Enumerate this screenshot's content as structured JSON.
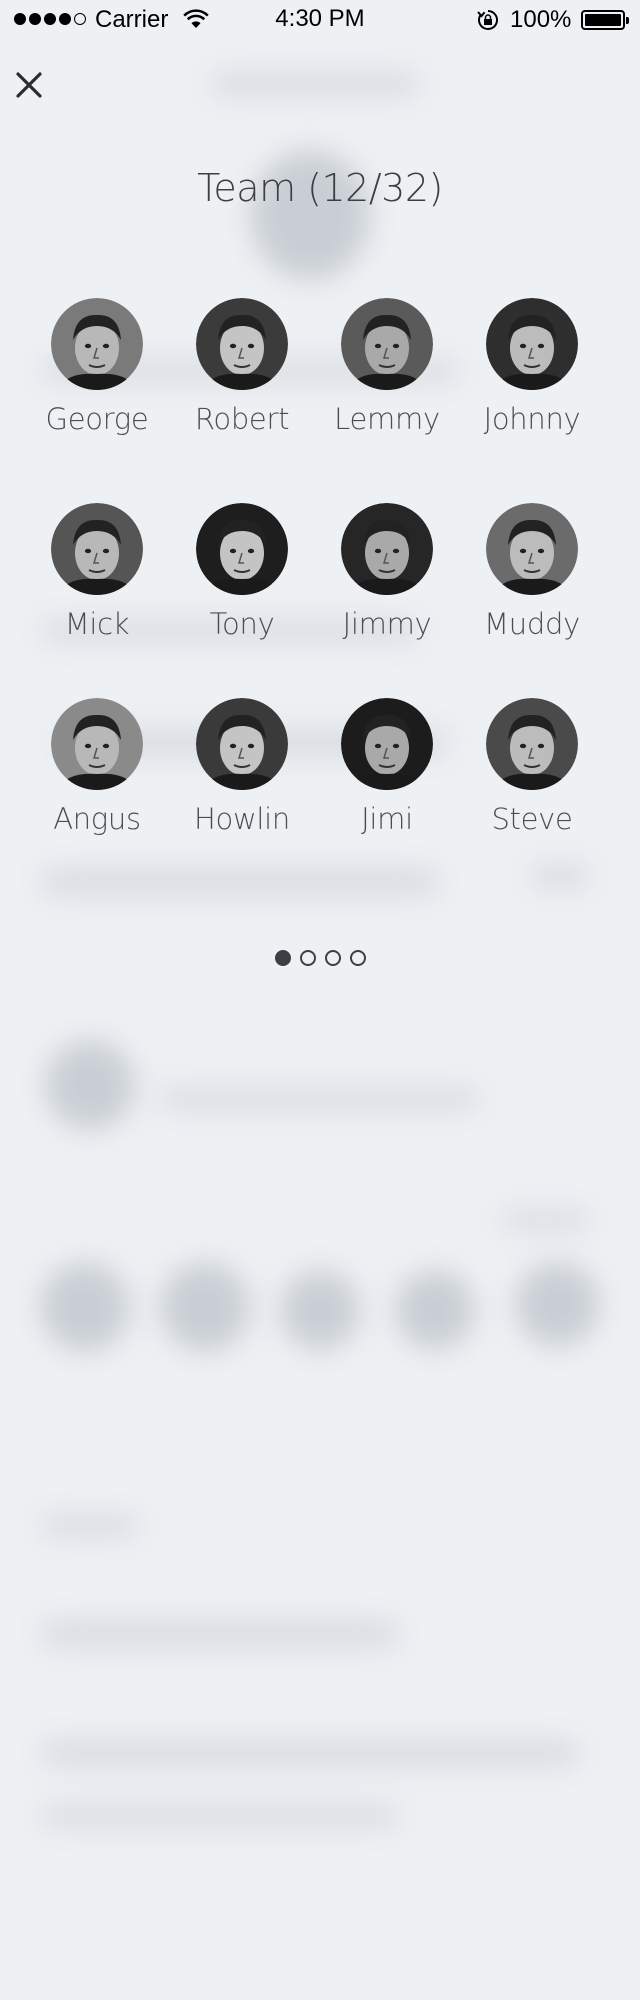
{
  "status_bar": {
    "carrier": "Carrier",
    "time": "4:30 PM",
    "battery": "100%",
    "battery_level": 1.0,
    "signal_bars_filled": 4,
    "signal_bars_total": 5
  },
  "header": {
    "close_icon": "close-icon",
    "title": "Team (12/32)"
  },
  "team": {
    "members": [
      {
        "name": "George",
        "tone": "#7a7a7a"
      },
      {
        "name": "Robert",
        "tone": "#3b3b3b"
      },
      {
        "name": "Lemmy",
        "tone": "#5a5a5a"
      },
      {
        "name": "Johnny",
        "tone": "#2e2e2e"
      },
      {
        "name": "Mick",
        "tone": "#555555"
      },
      {
        "name": "Tony",
        "tone": "#1e1e1e"
      },
      {
        "name": "Jimmy",
        "tone": "#262626"
      },
      {
        "name": "Muddy",
        "tone": "#6b6b6b"
      },
      {
        "name": "Angus",
        "tone": "#8a8a8a"
      },
      {
        "name": "Howlin",
        "tone": "#3a3a3a"
      },
      {
        "name": "Jimi",
        "tone": "#1c1c1c"
      },
      {
        "name": "Steve",
        "tone": "#4a4a4a"
      }
    ]
  },
  "pagination": {
    "total_pages": 4,
    "current_page": 1
  },
  "colors": {
    "background": "#eef1f4",
    "text": "#3c3f43"
  }
}
